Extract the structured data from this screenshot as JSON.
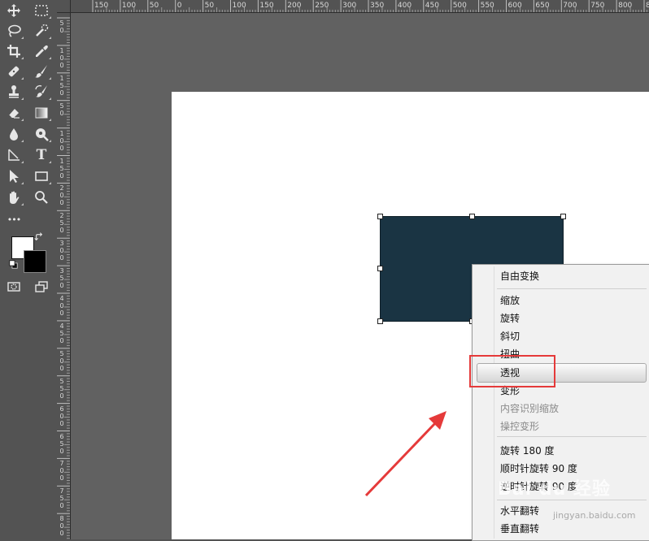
{
  "toolbar": {
    "tools": [
      {
        "icon": "move-icon"
      },
      {
        "icon": "marquee-icon"
      },
      {
        "icon": "lasso-icon"
      },
      {
        "icon": "quick-select-icon"
      },
      {
        "icon": "crop-icon"
      },
      {
        "icon": "eyedropper-icon"
      },
      {
        "icon": "healing-brush-icon"
      },
      {
        "icon": "brush-icon"
      },
      {
        "icon": "clone-stamp-icon"
      },
      {
        "icon": "history-brush-icon"
      },
      {
        "icon": "eraser-icon"
      },
      {
        "icon": "gradient-icon"
      },
      {
        "icon": "blur-icon"
      },
      {
        "icon": "dodge-icon"
      },
      {
        "icon": "pen-icon"
      },
      {
        "icon": "type-icon"
      },
      {
        "icon": "path-select-icon"
      },
      {
        "icon": "rectangle-icon"
      },
      {
        "icon": "hand-icon"
      },
      {
        "icon": "zoom-icon"
      },
      {
        "icon": "more-tools-icon"
      }
    ],
    "type_glyph": "T",
    "more_glyph": "•••",
    "foreground_color": "#ffffff",
    "background_color": "#000000"
  },
  "ruler_top": {
    "labels": [
      "150",
      "100",
      "50",
      "0",
      "50",
      "100",
      "150",
      "200",
      "250",
      "300",
      "350",
      "400",
      "450",
      "500",
      "550",
      "600",
      "650",
      "700",
      "750",
      "800",
      "850"
    ]
  },
  "ruler_left": {
    "labels": [
      "5\n0",
      "1\n0\n0",
      "1\n5\n0",
      "5\n0",
      "1\n0\n0",
      "1\n5\n0",
      "2\n0\n0",
      "2\n5\n0",
      "3\n0\n0",
      "3\n5\n0",
      "4\n0\n0",
      "4\n5\n0",
      "5\n0\n0",
      "5\n5\n0",
      "6\n0\n0",
      "6\n5\n0",
      "7\n0\n0",
      "7\n5\n0",
      "8\n0\n0"
    ]
  },
  "canvas": {
    "shape_color": "#1a3443"
  },
  "context_menu": {
    "items": [
      {
        "label": "自由变换",
        "enabled": true
      },
      {
        "label": "缩放",
        "enabled": true
      },
      {
        "label": "旋转",
        "enabled": true
      },
      {
        "label": "斜切",
        "enabled": true
      },
      {
        "label": "扭曲",
        "enabled": true
      },
      {
        "label": "透视",
        "enabled": true,
        "highlighted": true
      },
      {
        "label": "变形",
        "enabled": true
      },
      {
        "label": "内容识别缩放",
        "enabled": false
      },
      {
        "label": "操控变形",
        "enabled": false
      },
      {
        "label": "旋转 180 度",
        "enabled": true
      },
      {
        "label": "顺时针旋转 90 度",
        "enabled": true
      },
      {
        "label": "逆时针旋转 90 度",
        "enabled": true
      },
      {
        "label": "水平翻转",
        "enabled": true
      },
      {
        "label": "垂直翻转",
        "enabled": true
      }
    ]
  },
  "annotation": {
    "color": "#e53a3a"
  },
  "watermark": {
    "text": "Bai du 经验",
    "url": "jingyan.baidu.com"
  }
}
